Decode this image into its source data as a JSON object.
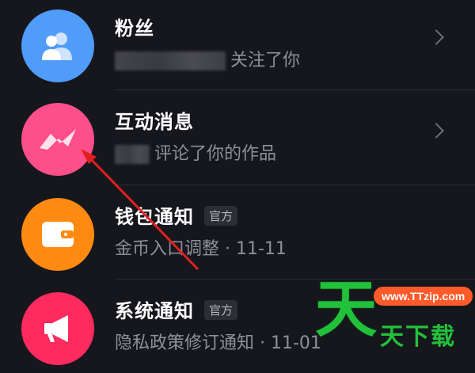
{
  "items": [
    {
      "title": "粉丝",
      "subtitle": "关注了你",
      "badge": null,
      "icon": "fans-icon",
      "color": "#4f9cf9"
    },
    {
      "title": "互动消息",
      "subtitle": "评论了你的作品",
      "badge": null,
      "icon": "interaction-icon",
      "color": "#ff4f8b"
    },
    {
      "title": "钱包通知",
      "subtitle": "金币入口调整 · 11-11",
      "badge": "官方",
      "icon": "wallet-icon",
      "color": "#ff8a12"
    },
    {
      "title": "系统通知",
      "subtitle": "隐私政策修订通知 · 11-01",
      "badge": "官方",
      "icon": "megaphone-icon",
      "color": "#ff2a5e"
    }
  ],
  "watermark": {
    "big_char": "天",
    "url": "www.TTzip.com",
    "text": "天下载"
  },
  "colors": {
    "background": "#16171d",
    "title": "#ffffff",
    "subtitle": "#8f9097",
    "annotation_arrow": "#e02020",
    "watermark_green": "#22c13b"
  }
}
